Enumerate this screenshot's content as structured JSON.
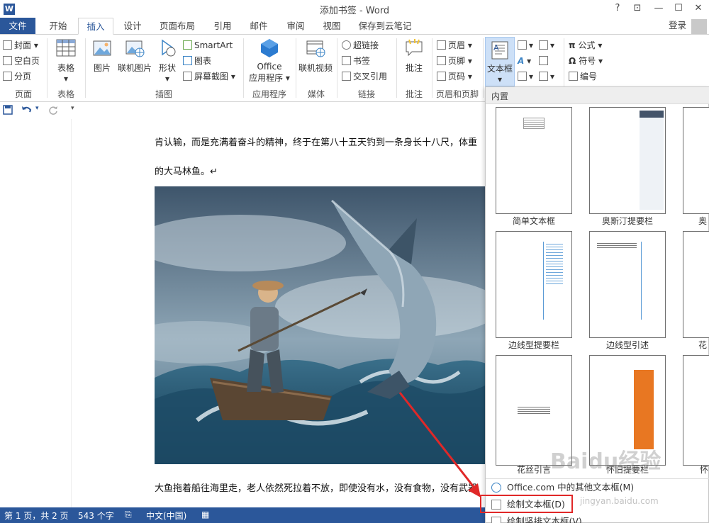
{
  "window": {
    "title": "添加书签 - Word",
    "app_icon": "W",
    "help": "?",
    "restore_ribbon": "⬜",
    "minimize": "—",
    "maximize": "☐",
    "close": "✕"
  },
  "tabs": [
    "文件",
    "开始",
    "插入",
    "设计",
    "页面布局",
    "引用",
    "邮件",
    "审阅",
    "视图",
    "保存到云笔记"
  ],
  "signin": "登录",
  "ribbon": {
    "pages_group": {
      "cover": "封面",
      "blank": "空白页",
      "page_break": "分页",
      "label": "页面"
    },
    "table_group": {
      "table": "表格",
      "label": "表格"
    },
    "illustrations_group": {
      "picture": "图片",
      "online_picture": "联机图片",
      "shapes": "形状",
      "smartart": "SmartArt",
      "chart": "图表",
      "screenshot": "屏幕截图",
      "label": "插图"
    },
    "apps_group": {
      "office_line1": "Office",
      "office_line2": "应用程序",
      "label": "应用程序"
    },
    "media_group": {
      "online_video": "联机视频",
      "label": "媒体"
    },
    "links_group": {
      "hyperlink": "超链接",
      "bookmark": "书签",
      "cross_ref": "交叉引用",
      "label": "链接"
    },
    "comments_group": {
      "comment": "批注",
      "label": "批注"
    },
    "header_footer_group": {
      "header": "页眉",
      "footer": "页脚",
      "page_number": "页码",
      "label": "页眉和页脚"
    },
    "text_group": {
      "textbox": "文本框"
    },
    "symbols_group": {
      "equation": "公式",
      "symbol": "符号",
      "number": "编号"
    }
  },
  "document": {
    "para1": "肯认输，而是充满着奋斗的精神，终于在第八十五天钓到一条身长十八尺，体重",
    "para2": "的大马林鱼。↵",
    "para3": "大鱼拖着船往海里走，老人依然死拉着不放，即使没有水，没有食物，没有武器"
  },
  "gallery": {
    "header": "内置",
    "captions": [
      "简单文本框",
      "奥斯汀提要栏",
      "边线型提要栏",
      "边线型引述",
      "花丝引言",
      "怀旧提要栏"
    ],
    "partial_captions": [
      "奥",
      "花",
      "怀"
    ],
    "menu": [
      "Office.com 中的其他文本框(M)",
      "绘制文本框(D)",
      "绘制竖排文本框(V)"
    ]
  },
  "status": {
    "page": "第 1 页，共 2 页",
    "words": "543 个字",
    "lang": "中文(中国)"
  },
  "watermark": {
    "brand": "Baidu经验",
    "url": "jingyan.baidu.com"
  },
  "colors": {
    "accent": "#2b579a",
    "highlight": "#e02828",
    "orange_sidebar": "#e87722"
  }
}
